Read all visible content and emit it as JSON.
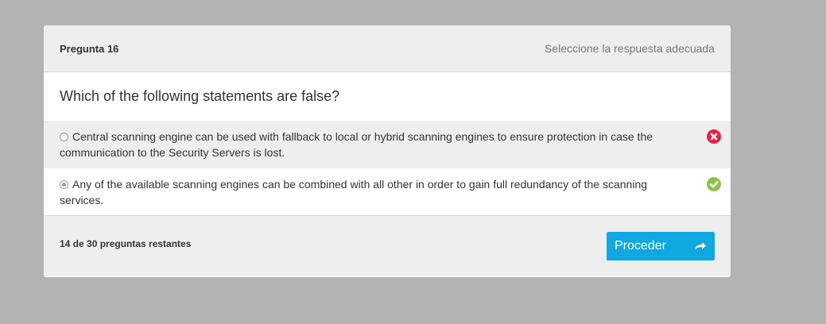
{
  "header": {
    "question_number": "Pregunta 16",
    "instruction": "Seleccione la respuesta adecuada"
  },
  "question": {
    "text": "Which of the following statements are false?"
  },
  "options": [
    {
      "text": "Central scanning engine can be used with fallback to local or hybrid scanning engines to ensure protection in case the communication to the Security Servers is lost.",
      "selected": false,
      "result": "incorrect",
      "result_icon": "x-circle-icon",
      "result_color": "#e8234a"
    },
    {
      "text": "Any of the available scanning engines can be combined with all other in order to gain full redundancy of the scanning services.",
      "selected": true,
      "result": "correct",
      "result_icon": "check-circle-icon",
      "result_color": "#8bc34a"
    }
  ],
  "footer": {
    "remaining": "14 de 30 preguntas restantes",
    "proceed_label": "Proceder",
    "proceed_icon": "share-arrow-icon",
    "proceed_color": "#10a8e0"
  }
}
